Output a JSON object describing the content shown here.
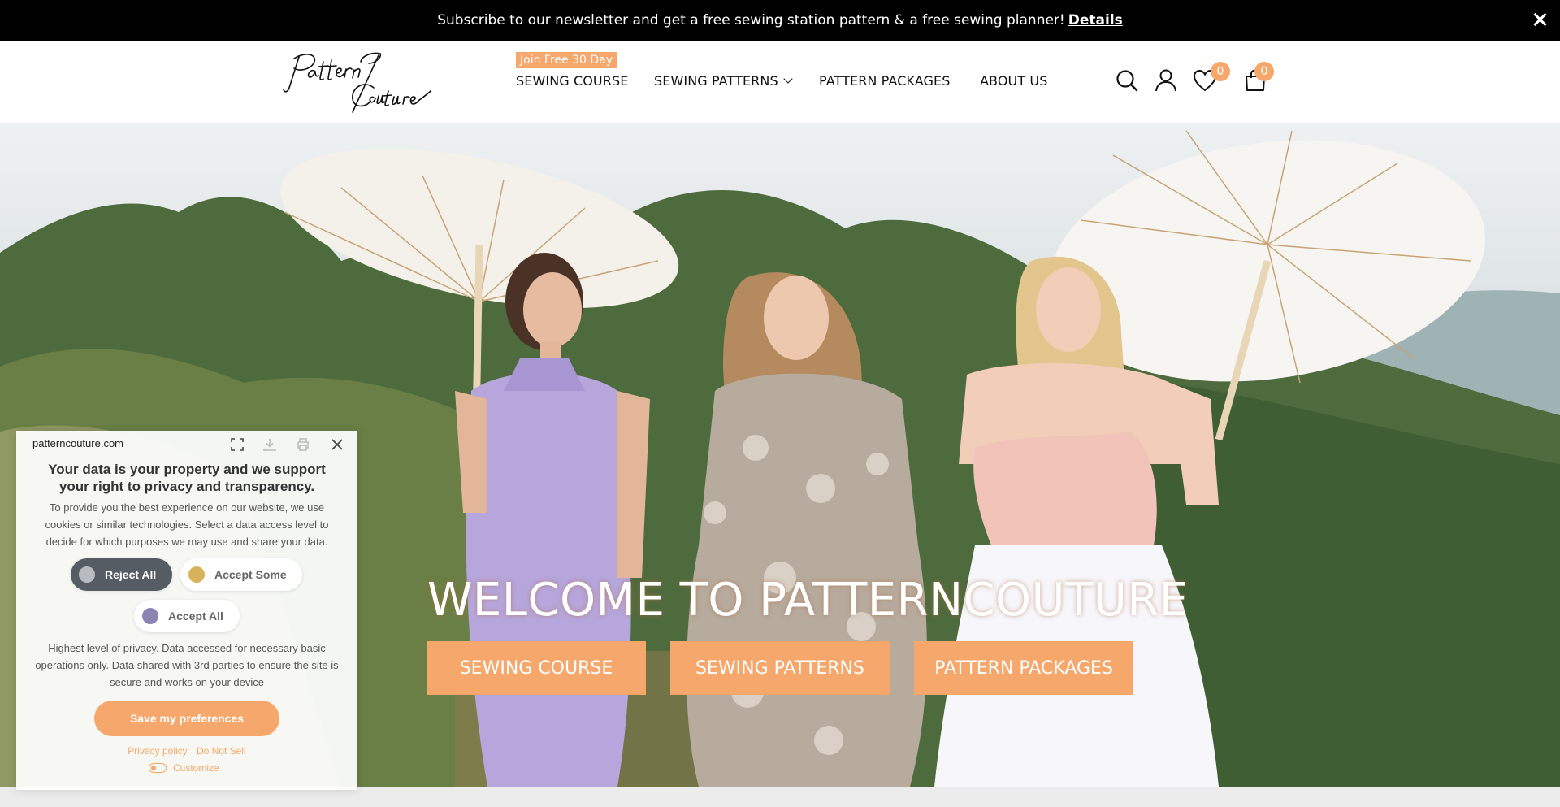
{
  "announcement": {
    "text": "Subscribe to our newsletter and get a free sewing station pattern & a free sewing planner!",
    "link": "Details"
  },
  "header": {
    "logo_text": "Pattern Couture",
    "nav": {
      "badge": "Join Free 30 Day",
      "sewing_course": "SEWING COURSE",
      "sewing_patterns": "SEWING PATTERNS",
      "pattern_packages": "PATTERN PACKAGES",
      "about_us": "ABOUT US"
    },
    "wishlist_count": "0",
    "cart_count": "0"
  },
  "hero": {
    "title": "WELCOME TO PATTERNCOUTURE",
    "buttons": {
      "course": "SEWING COURSE",
      "patterns": "SEWING PATTERNS",
      "packages": "PATTERN PACKAGES"
    }
  },
  "consent": {
    "domain": "patterncouture.com",
    "heading": "Your data is your property and we support your right to privacy and transparency.",
    "intro": "To provide you the best experience on our website, we use cookies or similar technologies. Select a data access level to decide for which purposes we may use and share your data.",
    "options": {
      "reject": "Reject All",
      "some": "Accept Some",
      "all": "Accept All"
    },
    "level_description": "Highest level of privacy. Data accessed for necessary basic operations only. Data shared with 3rd parties to ensure the site is secure and works on your device",
    "save": "Save my preferences",
    "privacy_policy": "Privacy policy",
    "do_not_sell": "Do Not Sell",
    "customize": "Customize"
  },
  "colors": {
    "accent": "#f6a76b",
    "announcement_bg": "#000000",
    "reject_pill": "#555c63",
    "some_dot": "#d8b25a",
    "all_dot": "#8c84b4",
    "reject_dot": "#b8bcc0"
  }
}
